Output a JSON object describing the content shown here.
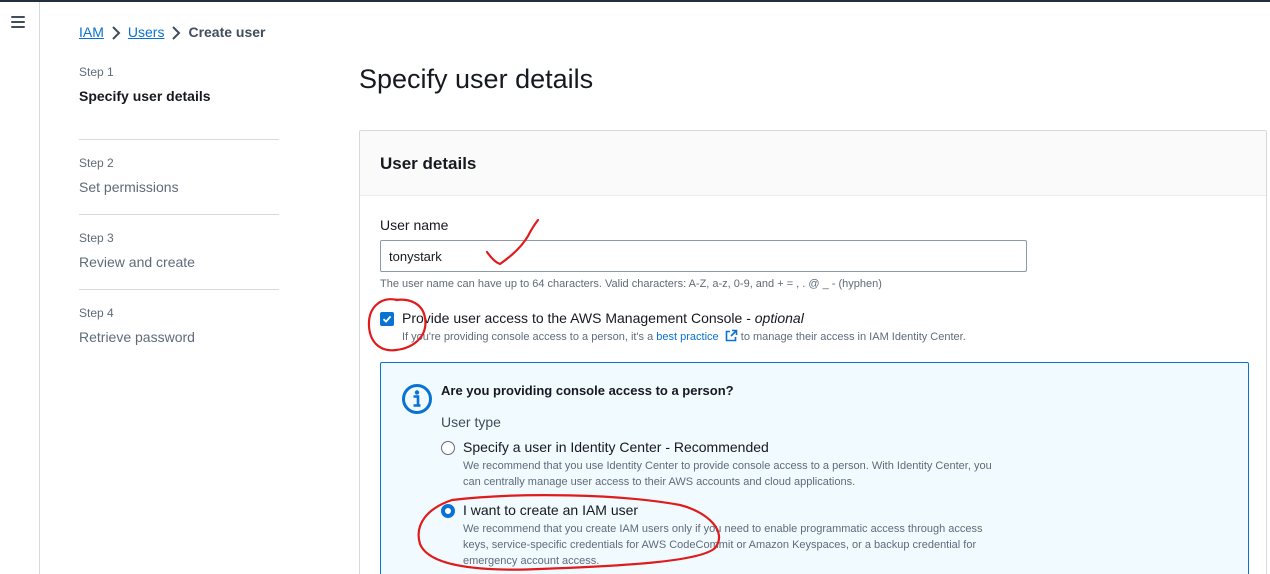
{
  "breadcrumb": {
    "items": [
      "IAM",
      "Users"
    ],
    "current": "Create user"
  },
  "steps": [
    {
      "number": "Step 1",
      "title": "Specify user details",
      "active": true
    },
    {
      "number": "Step 2",
      "title": "Set permissions",
      "active": false
    },
    {
      "number": "Step 3",
      "title": "Review and create",
      "active": false
    },
    {
      "number": "Step 4",
      "title": "Retrieve password",
      "active": false
    }
  ],
  "page": {
    "title": "Specify user details"
  },
  "panel": {
    "header": "User details",
    "user_name_label": "User name",
    "user_name_value": "tonystark",
    "constraint_text": "The user name can have up to 64 characters. Valid characters: A-Z, a-z, 0-9, and + = , . @ _ - (hyphen)",
    "console_access": {
      "label": "Provide user access to the AWS Management Console - ",
      "label_optional": "optional",
      "checked": true,
      "desc_before": "If you're providing console access to a person, it's a ",
      "desc_link": "best practice",
      "desc_after": " to manage their access in IAM Identity Center."
    },
    "info": {
      "title": "Are you providing console access to a person?",
      "user_type_label": "User type",
      "options": [
        {
          "label": "Specify a user in Identity Center - Recommended",
          "desc": "We recommend that you use Identity Center to provide console access to a person. With Identity Center, you can centrally manage user access to their AWS accounts and cloud applications.",
          "checked": false
        },
        {
          "label": "I want to create an IAM user",
          "desc": "We recommend that you create IAM users only if you need to enable programmatic access through access keys, service-specific credentials for AWS CodeCommit or Amazon Keyspaces, or a backup credential for emergency account access.",
          "checked": true
        }
      ]
    }
  },
  "colors": {
    "accent": "#0972d3",
    "annotation": "#e01b1b"
  },
  "icons": [
    "menu-icon",
    "chevron-right-icon",
    "checkmark-icon",
    "external-link-icon",
    "info-icon"
  ]
}
